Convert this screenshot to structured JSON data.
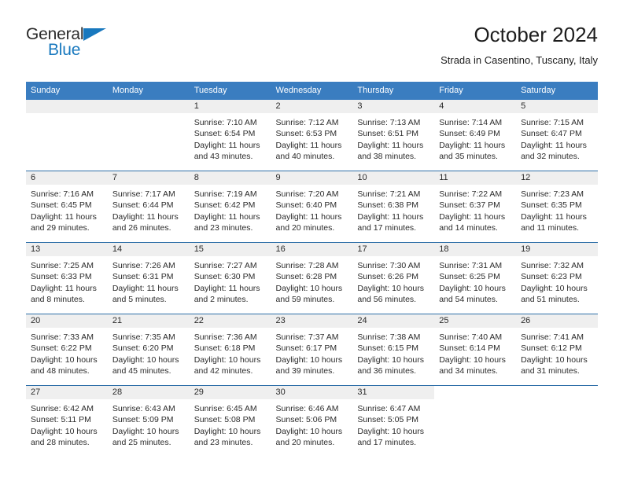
{
  "brand": {
    "word_one": "General",
    "word_two": "Blue",
    "triangle_icon": "triangle-icon",
    "accent_color": "#1878be"
  },
  "header": {
    "title": "October 2024",
    "subtitle": "Strada in Casentino, Tuscany, Italy"
  },
  "theme": {
    "header_blue": "#3a7dc0",
    "rule_blue": "#2e6fa8",
    "strip_gray": "#efefef"
  },
  "calendar": {
    "weekday_headers": [
      "Sunday",
      "Monday",
      "Tuesday",
      "Wednesday",
      "Thursday",
      "Friday",
      "Saturday"
    ],
    "weeks": [
      [
        {
          "day": "",
          "sunrise": "",
          "sunset": "",
          "daylight_line1": "",
          "daylight_line2": ""
        },
        {
          "day": "",
          "sunrise": "",
          "sunset": "",
          "daylight_line1": "",
          "daylight_line2": ""
        },
        {
          "day": "1",
          "sunrise": "Sunrise: 7:10 AM",
          "sunset": "Sunset: 6:54 PM",
          "daylight_line1": "Daylight: 11 hours",
          "daylight_line2": "and 43 minutes."
        },
        {
          "day": "2",
          "sunrise": "Sunrise: 7:12 AM",
          "sunset": "Sunset: 6:53 PM",
          "daylight_line1": "Daylight: 11 hours",
          "daylight_line2": "and 40 minutes."
        },
        {
          "day": "3",
          "sunrise": "Sunrise: 7:13 AM",
          "sunset": "Sunset: 6:51 PM",
          "daylight_line1": "Daylight: 11 hours",
          "daylight_line2": "and 38 minutes."
        },
        {
          "day": "4",
          "sunrise": "Sunrise: 7:14 AM",
          "sunset": "Sunset: 6:49 PM",
          "daylight_line1": "Daylight: 11 hours",
          "daylight_line2": "and 35 minutes."
        },
        {
          "day": "5",
          "sunrise": "Sunrise: 7:15 AM",
          "sunset": "Sunset: 6:47 PM",
          "daylight_line1": "Daylight: 11 hours",
          "daylight_line2": "and 32 minutes."
        }
      ],
      [
        {
          "day": "6",
          "sunrise": "Sunrise: 7:16 AM",
          "sunset": "Sunset: 6:45 PM",
          "daylight_line1": "Daylight: 11 hours",
          "daylight_line2": "and 29 minutes."
        },
        {
          "day": "7",
          "sunrise": "Sunrise: 7:17 AM",
          "sunset": "Sunset: 6:44 PM",
          "daylight_line1": "Daylight: 11 hours",
          "daylight_line2": "and 26 minutes."
        },
        {
          "day": "8",
          "sunrise": "Sunrise: 7:19 AM",
          "sunset": "Sunset: 6:42 PM",
          "daylight_line1": "Daylight: 11 hours",
          "daylight_line2": "and 23 minutes."
        },
        {
          "day": "9",
          "sunrise": "Sunrise: 7:20 AM",
          "sunset": "Sunset: 6:40 PM",
          "daylight_line1": "Daylight: 11 hours",
          "daylight_line2": "and 20 minutes."
        },
        {
          "day": "10",
          "sunrise": "Sunrise: 7:21 AM",
          "sunset": "Sunset: 6:38 PM",
          "daylight_line1": "Daylight: 11 hours",
          "daylight_line2": "and 17 minutes."
        },
        {
          "day": "11",
          "sunrise": "Sunrise: 7:22 AM",
          "sunset": "Sunset: 6:37 PM",
          "daylight_line1": "Daylight: 11 hours",
          "daylight_line2": "and 14 minutes."
        },
        {
          "day": "12",
          "sunrise": "Sunrise: 7:23 AM",
          "sunset": "Sunset: 6:35 PM",
          "daylight_line1": "Daylight: 11 hours",
          "daylight_line2": "and 11 minutes."
        }
      ],
      [
        {
          "day": "13",
          "sunrise": "Sunrise: 7:25 AM",
          "sunset": "Sunset: 6:33 PM",
          "daylight_line1": "Daylight: 11 hours",
          "daylight_line2": "and 8 minutes."
        },
        {
          "day": "14",
          "sunrise": "Sunrise: 7:26 AM",
          "sunset": "Sunset: 6:31 PM",
          "daylight_line1": "Daylight: 11 hours",
          "daylight_line2": "and 5 minutes."
        },
        {
          "day": "15",
          "sunrise": "Sunrise: 7:27 AM",
          "sunset": "Sunset: 6:30 PM",
          "daylight_line1": "Daylight: 11 hours",
          "daylight_line2": "and 2 minutes."
        },
        {
          "day": "16",
          "sunrise": "Sunrise: 7:28 AM",
          "sunset": "Sunset: 6:28 PM",
          "daylight_line1": "Daylight: 10 hours",
          "daylight_line2": "and 59 minutes."
        },
        {
          "day": "17",
          "sunrise": "Sunrise: 7:30 AM",
          "sunset": "Sunset: 6:26 PM",
          "daylight_line1": "Daylight: 10 hours",
          "daylight_line2": "and 56 minutes."
        },
        {
          "day": "18",
          "sunrise": "Sunrise: 7:31 AM",
          "sunset": "Sunset: 6:25 PM",
          "daylight_line1": "Daylight: 10 hours",
          "daylight_line2": "and 54 minutes."
        },
        {
          "day": "19",
          "sunrise": "Sunrise: 7:32 AM",
          "sunset": "Sunset: 6:23 PM",
          "daylight_line1": "Daylight: 10 hours",
          "daylight_line2": "and 51 minutes."
        }
      ],
      [
        {
          "day": "20",
          "sunrise": "Sunrise: 7:33 AM",
          "sunset": "Sunset: 6:22 PM",
          "daylight_line1": "Daylight: 10 hours",
          "daylight_line2": "and 48 minutes."
        },
        {
          "day": "21",
          "sunrise": "Sunrise: 7:35 AM",
          "sunset": "Sunset: 6:20 PM",
          "daylight_line1": "Daylight: 10 hours",
          "daylight_line2": "and 45 minutes."
        },
        {
          "day": "22",
          "sunrise": "Sunrise: 7:36 AM",
          "sunset": "Sunset: 6:18 PM",
          "daylight_line1": "Daylight: 10 hours",
          "daylight_line2": "and 42 minutes."
        },
        {
          "day": "23",
          "sunrise": "Sunrise: 7:37 AM",
          "sunset": "Sunset: 6:17 PM",
          "daylight_line1": "Daylight: 10 hours",
          "daylight_line2": "and 39 minutes."
        },
        {
          "day": "24",
          "sunrise": "Sunrise: 7:38 AM",
          "sunset": "Sunset: 6:15 PM",
          "daylight_line1": "Daylight: 10 hours",
          "daylight_line2": "and 36 minutes."
        },
        {
          "day": "25",
          "sunrise": "Sunrise: 7:40 AM",
          "sunset": "Sunset: 6:14 PM",
          "daylight_line1": "Daylight: 10 hours",
          "daylight_line2": "and 34 minutes."
        },
        {
          "day": "26",
          "sunrise": "Sunrise: 7:41 AM",
          "sunset": "Sunset: 6:12 PM",
          "daylight_line1": "Daylight: 10 hours",
          "daylight_line2": "and 31 minutes."
        }
      ],
      [
        {
          "day": "27",
          "sunrise": "Sunrise: 6:42 AM",
          "sunset": "Sunset: 5:11 PM",
          "daylight_line1": "Daylight: 10 hours",
          "daylight_line2": "and 28 minutes."
        },
        {
          "day": "28",
          "sunrise": "Sunrise: 6:43 AM",
          "sunset": "Sunset: 5:09 PM",
          "daylight_line1": "Daylight: 10 hours",
          "daylight_line2": "and 25 minutes."
        },
        {
          "day": "29",
          "sunrise": "Sunrise: 6:45 AM",
          "sunset": "Sunset: 5:08 PM",
          "daylight_line1": "Daylight: 10 hours",
          "daylight_line2": "and 23 minutes."
        },
        {
          "day": "30",
          "sunrise": "Sunrise: 6:46 AM",
          "sunset": "Sunset: 5:06 PM",
          "daylight_line1": "Daylight: 10 hours",
          "daylight_line2": "and 20 minutes."
        },
        {
          "day": "31",
          "sunrise": "Sunrise: 6:47 AM",
          "sunset": "Sunset: 5:05 PM",
          "daylight_line1": "Daylight: 10 hours",
          "daylight_line2": "and 17 minutes."
        },
        {
          "day": "",
          "sunrise": "",
          "sunset": "",
          "daylight_line1": "",
          "daylight_line2": ""
        },
        {
          "day": "",
          "sunrise": "",
          "sunset": "",
          "daylight_line1": "",
          "daylight_line2": ""
        }
      ]
    ]
  }
}
